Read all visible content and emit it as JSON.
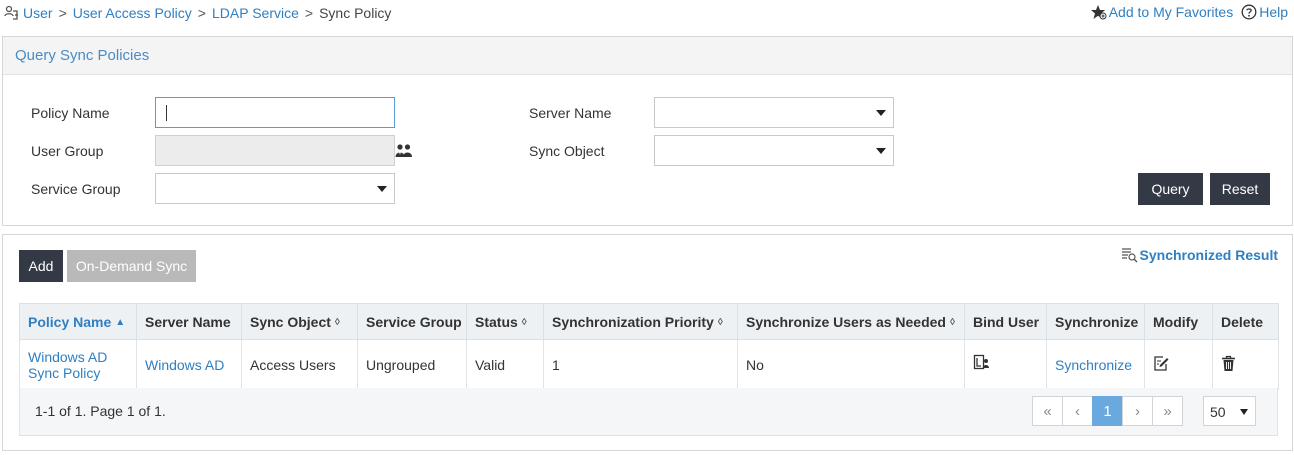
{
  "breadcrumb": {
    "items": [
      "User",
      "User Access Policy",
      "LDAP Service"
    ],
    "current": "Sync Policy",
    "separator": ">"
  },
  "header_links": {
    "favorites": "Add to My Favorites",
    "help": "Help"
  },
  "query_panel": {
    "title": "Query Sync Policies",
    "policy_name_label": "Policy Name",
    "policy_name_value": "",
    "user_group_label": "User Group",
    "user_group_value": "",
    "service_group_label": "Service Group",
    "service_group_value": "",
    "server_name_label": "Server Name",
    "server_name_value": "",
    "sync_object_label": "Sync Object",
    "sync_object_value": "",
    "query_button": "Query",
    "reset_button": "Reset"
  },
  "list_panel": {
    "add_button": "Add",
    "on_demand_button": "On-Demand Sync",
    "synchronized_result": "Synchronized Result",
    "columns": [
      "Policy Name",
      "Server Name",
      "Sync Object",
      "Service Group",
      "Status",
      "Synchronization Priority",
      "Synchronize Users as Needed",
      "Bind User",
      "Synchronize",
      "Modify",
      "Delete"
    ],
    "rows": [
      {
        "policy_name": "Windows AD Sync Policy",
        "server_name": "Windows AD",
        "sync_object": "Access Users",
        "service_group": "Ungrouped",
        "status": "Valid",
        "priority": "1",
        "sync_as_needed": "No",
        "synchronize": "Synchronize"
      }
    ],
    "pager": {
      "info": "1-1 of 1. Page 1 of 1.",
      "first": "«",
      "prev": "‹",
      "current": "1",
      "next": "›",
      "last": "»",
      "page_size": "50"
    }
  },
  "icons": {
    "breadcrumb": "user-tree-icon",
    "favorites": "star-icon",
    "help": "question-circle-icon",
    "user_group": "users-icon",
    "synchronized_result": "list-search-icon",
    "bind_user": "bind-user-icon",
    "modify": "edit-icon",
    "delete": "trash-icon"
  },
  "colors": {
    "link": "#2f7fc1",
    "panel_title": "#4a8bc7",
    "dark_button": "#333a45",
    "disabled_button": "#b9b9b9",
    "active_page": "#6aa9dd"
  }
}
